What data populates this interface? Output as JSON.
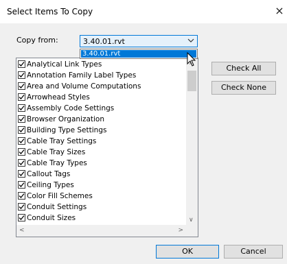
{
  "dialog": {
    "title": "Select Items To Copy",
    "close_glyph": "×"
  },
  "copy_from": {
    "label": "Copy from:",
    "selected": "3.40.01.rvt",
    "options": [
      "3.40.01.rvt"
    ],
    "arrow_icon": "chevron-down-icon"
  },
  "items": [
    {
      "label": "Analytical Link Types",
      "checked": true
    },
    {
      "label": "Annotation Family Label Types",
      "checked": true
    },
    {
      "label": "Area and Volume Computations",
      "checked": true
    },
    {
      "label": "Arrowhead Styles",
      "checked": true
    },
    {
      "label": "Assembly Code Settings",
      "checked": true
    },
    {
      "label": "Browser Organization",
      "checked": true
    },
    {
      "label": "Building Type Settings",
      "checked": true
    },
    {
      "label": "Cable Tray Settings",
      "checked": true
    },
    {
      "label": "Cable Tray Sizes",
      "checked": true
    },
    {
      "label": "Cable Tray Types",
      "checked": true
    },
    {
      "label": "Callout Tags",
      "checked": true
    },
    {
      "label": "Ceiling Types",
      "checked": true
    },
    {
      "label": "Color Fill Schemes",
      "checked": true
    },
    {
      "label": "Conduit Settings",
      "checked": true
    },
    {
      "label": "Conduit Sizes",
      "checked": true
    }
  ],
  "buttons": {
    "check_all": "Check All",
    "check_none": "Check None",
    "ok": "OK",
    "cancel": "Cancel"
  },
  "scroll": {
    "up": "∧",
    "down": "∨",
    "left": "<",
    "right": ">"
  }
}
